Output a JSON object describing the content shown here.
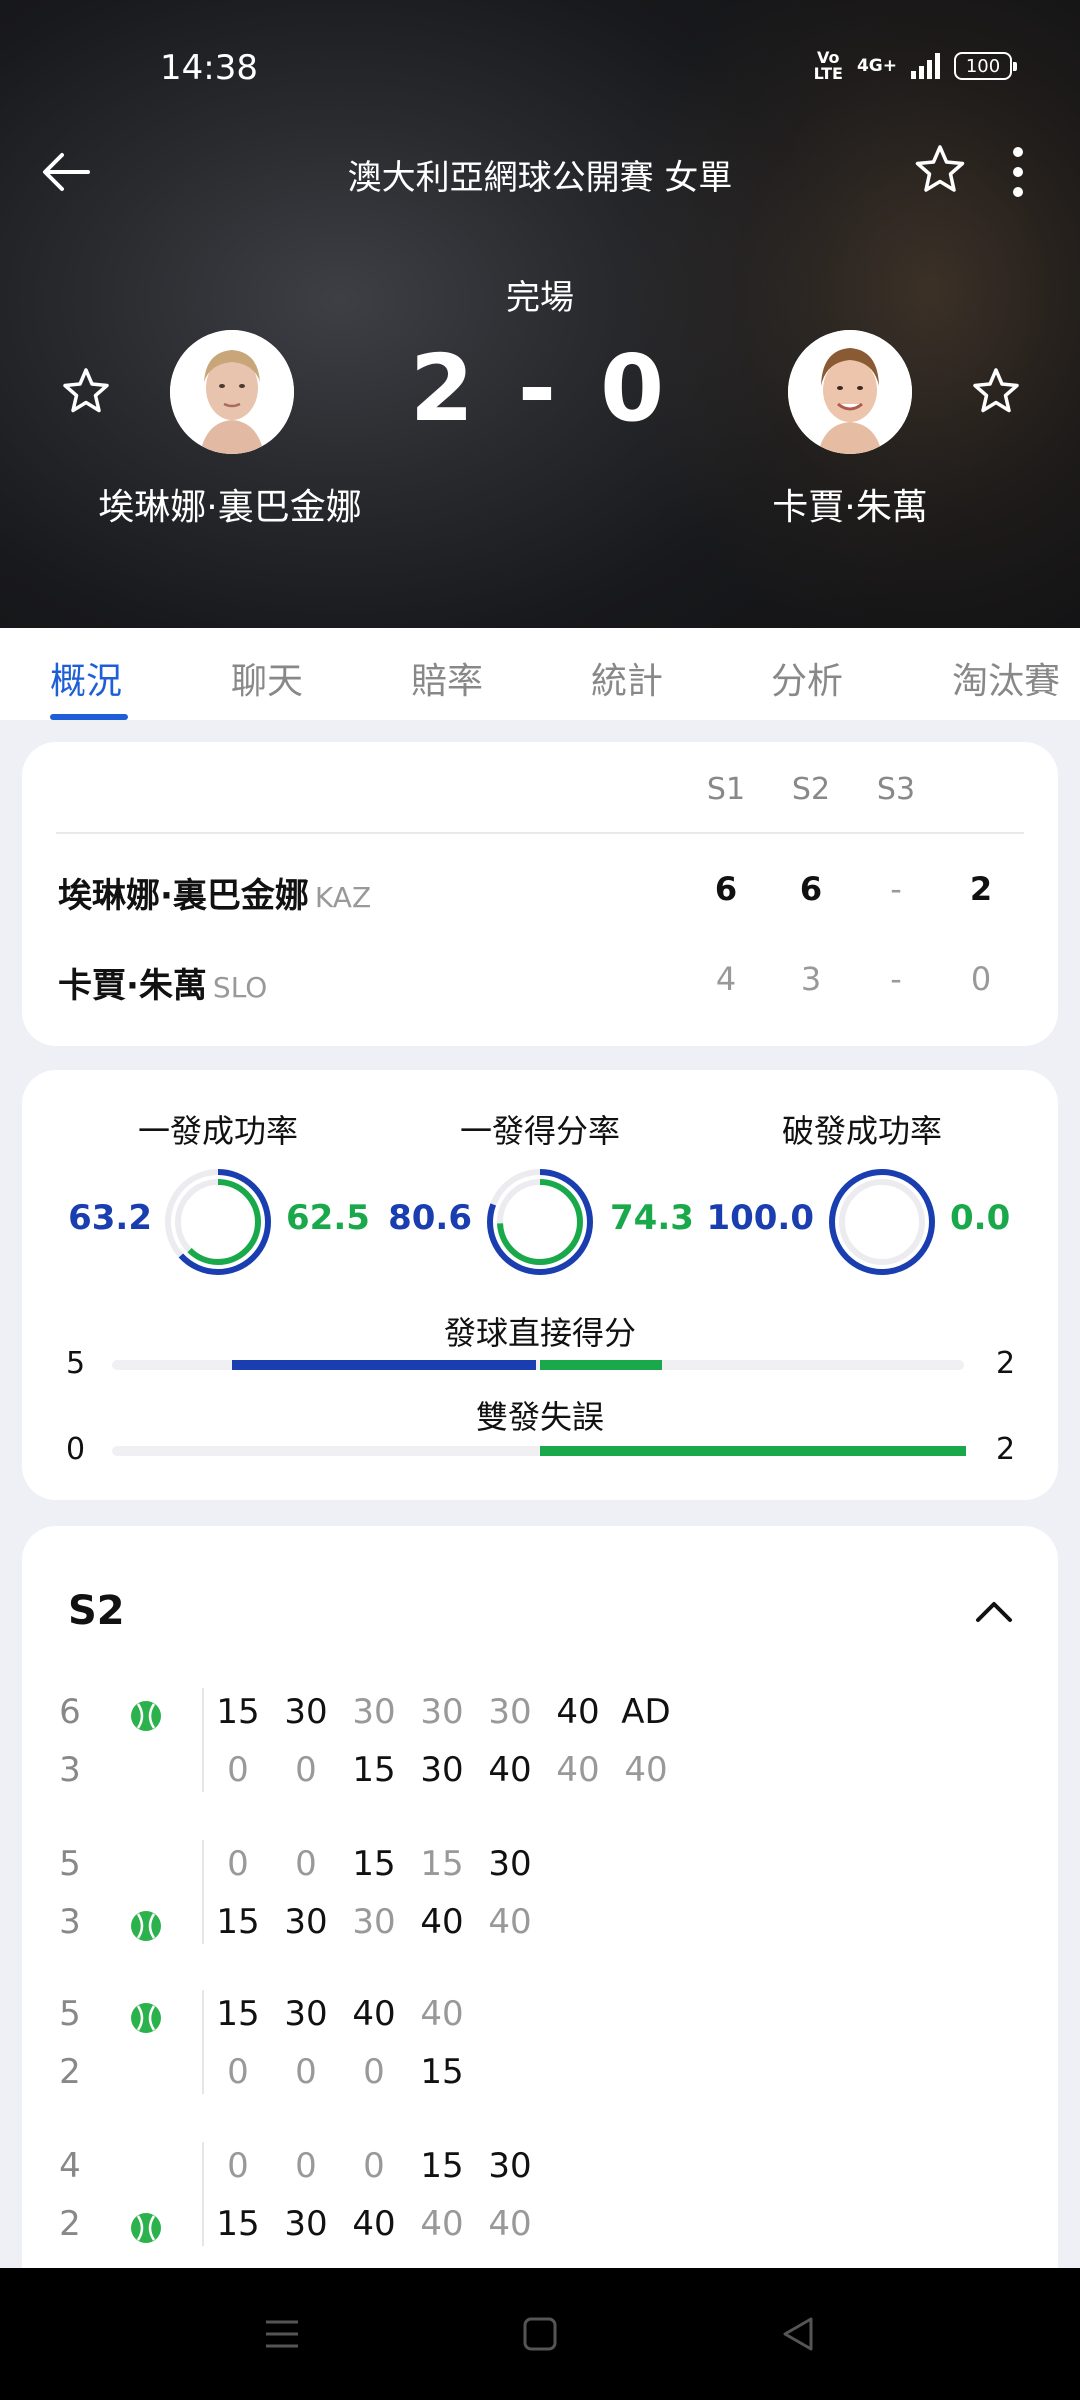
{
  "status_bar": {
    "time": "14:38",
    "volte_top": "Vo",
    "volte_bottom": "LTE",
    "network": "4G+",
    "battery": "100"
  },
  "header": {
    "title": "澳大利亞網球公開賽 女單",
    "match_status": "完場",
    "score": "2 - 0"
  },
  "players": [
    {
      "name": "埃琳娜·裏巴金娜",
      "country": "KAZ"
    },
    {
      "name": "卡賈·朱萬",
      "country": "SLO"
    }
  ],
  "tabs": [
    "概況",
    "聊天",
    "賠率",
    "統計",
    "分析",
    "淘汰賽"
  ],
  "active_tab": 0,
  "score_table": {
    "headers": [
      "S1",
      "S2",
      "S3"
    ],
    "rows": [
      {
        "sets": [
          "6",
          "6",
          "-"
        ],
        "total": "2",
        "winner": true
      },
      {
        "sets": [
          "4",
          "3",
          "-"
        ],
        "total": "0",
        "winner": false
      }
    ]
  },
  "stats": {
    "rings": [
      {
        "label": "一發成功率",
        "left": "63.2",
        "right": "62.5",
        "left_value": 63.2,
        "right_value": 62.5
      },
      {
        "label": "一發得分率",
        "left": "80.6",
        "right": "74.3",
        "left_value": 80.6,
        "right_value": 74.3
      },
      {
        "label": "破發成功率",
        "left": "100.0",
        "right": "0.0",
        "left_value": 100.0,
        "right_value": 0.0
      }
    ],
    "bars": [
      {
        "label": "發球直接得分",
        "left": "5",
        "right": "2",
        "left_value": 5,
        "right_value": 2
      },
      {
        "label": "雙發失誤",
        "left": "0",
        "right": "2",
        "left_value": 0,
        "right_value": 2
      }
    ]
  },
  "set_detail": {
    "title": "S2",
    "games": [
      {
        "score_top": "6",
        "score_bottom": "3",
        "server": "top",
        "points": [
          [
            "15",
            "b",
            "0",
            "g"
          ],
          [
            "30",
            "b",
            "0",
            "g"
          ],
          [
            "30",
            "g",
            "15",
            "b"
          ],
          [
            "30",
            "g",
            "30",
            "b"
          ],
          [
            "30",
            "g",
            "40",
            "b"
          ],
          [
            "40",
            "b",
            "40",
            "g"
          ],
          [
            "AD",
            "b",
            "40",
            "g"
          ]
        ]
      },
      {
        "score_top": "5",
        "score_bottom": "3",
        "server": "bottom",
        "points": [
          [
            "0",
            "g",
            "15",
            "b"
          ],
          [
            "0",
            "g",
            "30",
            "b"
          ],
          [
            "15",
            "b",
            "30",
            "g"
          ],
          [
            "15",
            "g",
            "40",
            "b"
          ],
          [
            "30",
            "b",
            "40",
            "g"
          ]
        ]
      },
      {
        "score_top": "5",
        "score_bottom": "2",
        "server": "top",
        "points": [
          [
            "15",
            "b",
            "0",
            "g"
          ],
          [
            "30",
            "b",
            "0",
            "g"
          ],
          [
            "40",
            "b",
            "0",
            "g"
          ],
          [
            "40",
            "g",
            "15",
            "b"
          ]
        ]
      },
      {
        "score_top": "4",
        "score_bottom": "2",
        "server": "bottom",
        "points": [
          [
            "0",
            "g",
            "15",
            "b"
          ],
          [
            "0",
            "g",
            "30",
            "b"
          ],
          [
            "0",
            "g",
            "40",
            "b"
          ],
          [
            "15",
            "b",
            "40",
            "g"
          ],
          [
            "30",
            "b",
            "40",
            "g"
          ]
        ]
      }
    ]
  },
  "colors": {
    "accent": "#1e5fd8",
    "player1": "#1a3eb0",
    "player2": "#1aa94a",
    "ball": "#2bb24c"
  }
}
